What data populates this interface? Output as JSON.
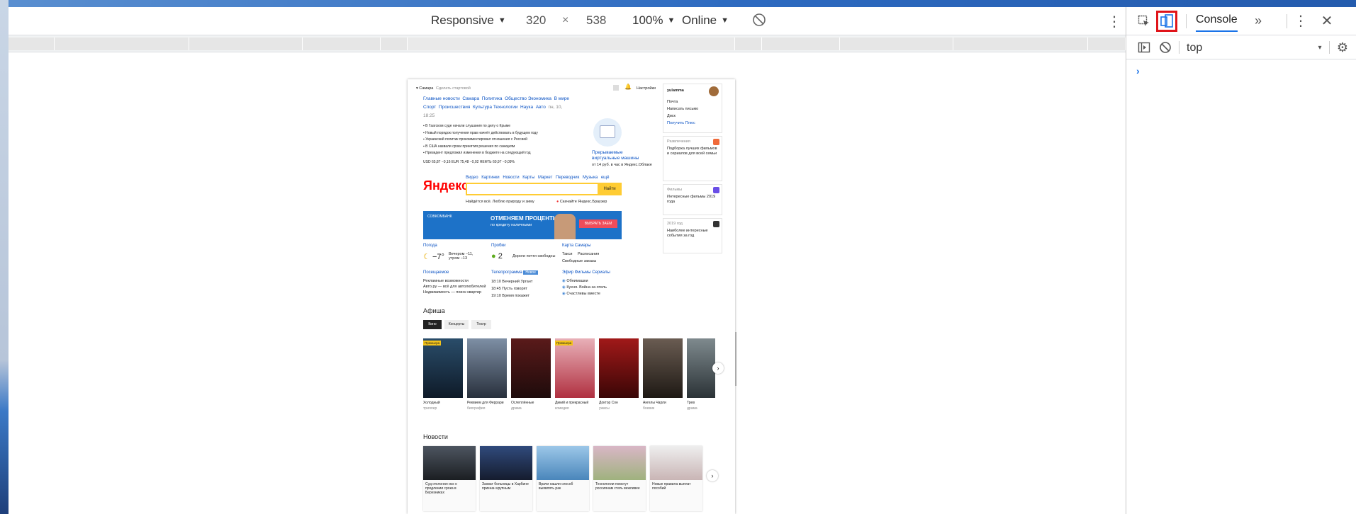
{
  "toolbar": {
    "device": "Responsive",
    "width": "320",
    "times": "×",
    "height": "538",
    "zoom": "100%",
    "throttle": "Online"
  },
  "devtools": {
    "console_tab": "Console",
    "more_tabs": "»",
    "context": "top",
    "prompt": "›"
  },
  "page": {
    "header": {
      "location": "Самара",
      "make_start": "Сделать стартовой",
      "settings": "Настройки"
    },
    "news_tabs": [
      "Главные новости",
      "Самара",
      "Политика",
      "Общество",
      "Экономика",
      "В мире",
      "Спорт",
      "Происшествия",
      "Культура",
      "Технологии",
      "Наука",
      "Авто"
    ],
    "news_date": "пн, 10, 18:25",
    "news_items": [
      "В Гаагском суде начали слушания по делу о Крыме",
      "Новый порядок получения прав начнёт действовать в будущем году",
      "Украинский политик прокомментировал отношения с Россией",
      "В США назвали сроки принятия решения по санкциям",
      "Президент предложил изменения в бюджете на следующий год"
    ],
    "rates": "USD 65,87 −0,16  EUR 75,48 −0,02  НЕФТЬ 60,97 −0,09%",
    "promo_title": "Прерываемые виртуальные машины",
    "promo_sub": "от 14 руб. в час в Яндекс.Облаке",
    "logo": "Яндекс",
    "services": [
      "Видео",
      "Картинки",
      "Новости",
      "Карты",
      "Маркет",
      "Переводчик",
      "Музыка",
      "ещё"
    ],
    "search_button": "Найти",
    "search_hint": "Найдётся всё. Люблю природу и зиму",
    "browser_promo": "Скачайте Яндекс.Браузер",
    "banner_title": "ОТМЕНЯЕМ ПРОЦЕНТЫ",
    "banner_sub": "по кредиту наличными",
    "banner_button": "ВЫБРАТЬ ЗАЕМ",
    "banner_brand": "СОВКОМБАНК",
    "weather_title": "Погода",
    "weather_temp": "−7°",
    "weather_detail": "Вечером −11, утром −13",
    "traffic_title": "Пробки",
    "traffic_score": "2",
    "traffic_detail": "Дороги почти свободны",
    "map_title": "Карта Самары",
    "map_items": [
      "Такси",
      "Расписания",
      "Свободные заказы"
    ],
    "visited_title": "Посещаемое",
    "visited_items": [
      "Рекламные возможности",
      "Авто.ру — всё для автолюбителей",
      "Недвижимость — поиск квартир"
    ],
    "tv_title": "Телепрограмма",
    "tv_badge": "Новое",
    "tv_items": [
      "18:10 Вечерний Ургант",
      "18:45 Пусть говорят",
      "19:10 Время покажет"
    ],
    "ether_title": "Эфир Фильмы Сериалы",
    "ether_items": [
      "Обнимашки",
      "Кухня. Война за отель",
      "Счастливы вместе"
    ],
    "afisha_title": "Афиша",
    "afisha_tabs": [
      "Кино",
      "Концерты",
      "Театр"
    ],
    "posters": [
      {
        "title": "Холодный",
        "genre": "триллер",
        "badge": "Премьера"
      },
      {
        "title": "Реквием для Феррари",
        "genre": "биография",
        "badge": ""
      },
      {
        "title": "Ослеплённые",
        "genre": "драма",
        "badge": ""
      },
      {
        "title": "Дикий и прекрасный",
        "genre": "комедия",
        "badge": "Премьера"
      },
      {
        "title": "Доктор Сон",
        "genre": "ужасы",
        "badge": ""
      },
      {
        "title": "Ангелы Чарли",
        "genre": "боевик",
        "badge": ""
      },
      {
        "title": "Трев",
        "genre": "драма",
        "badge": ""
      }
    ],
    "news_title": "Новости",
    "news_cards": [
      "Суд отклонил иск о продлении срока в Березниках",
      "Захват больницы в Харбине признан крупным",
      "Врачи нашли способ выявлять рак",
      "Технологии помогут россиянам стать вежливее",
      "Новые правила выплат пособий"
    ],
    "sidebar": {
      "user": "yulamma",
      "links": [
        "Почта",
        "Написать письмо",
        "Диск",
        "Получить Плюс"
      ],
      "card1_title": "Развлечения",
      "card1_text": "Подборка лучших фильмов и сериалов для всей семьи",
      "card2_title": "Фильмы",
      "card2_text": "Интересные фильмы 2019 года",
      "card3_title": "2019 год",
      "card3_text": "Наиболее интересные события за год"
    }
  }
}
